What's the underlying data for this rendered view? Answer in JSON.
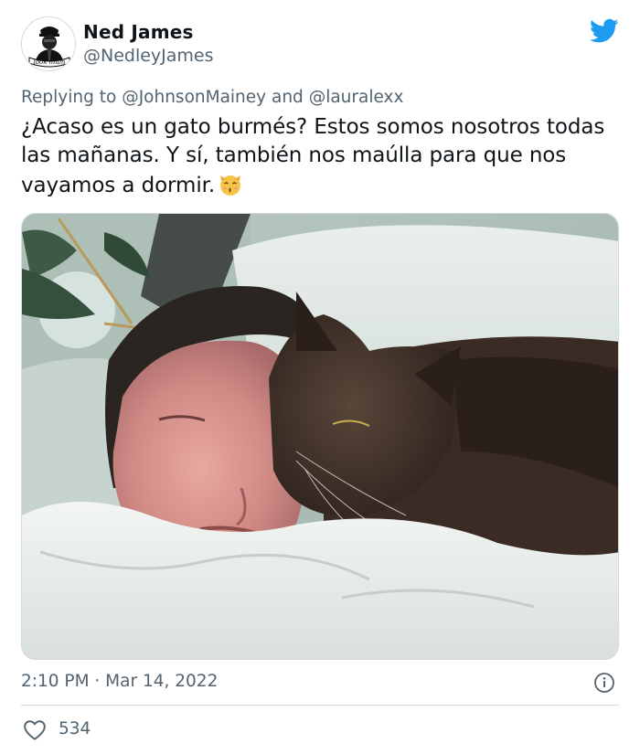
{
  "tweet": {
    "author_name": "Ned James",
    "author_handle": "@NedleyJames",
    "avatar_caption": "look mum",
    "reply_prefix": "Replying to",
    "reply_mention_1": "@JohnsonMainey",
    "reply_and": "and",
    "reply_mention_2": "@lauralexx",
    "text": "¿Acaso es un gato burmés? Estos somos nosotros todas las mañanas. Y sí, también nos maúlla para que nos vayamos a dormir.",
    "emoji_icon": "kissing-cat-emoji",
    "timestamp": "2:10 PM · Mar 14, 2022",
    "like_count": "534"
  },
  "colors": {
    "brand": "#1d9bf0",
    "text_primary": "#0f1419",
    "text_secondary": "#536471",
    "divider": "#cfd9de"
  },
  "icons": {
    "logo": "twitter-bird-icon",
    "info": "info-icon",
    "like": "heart-outline-icon"
  }
}
